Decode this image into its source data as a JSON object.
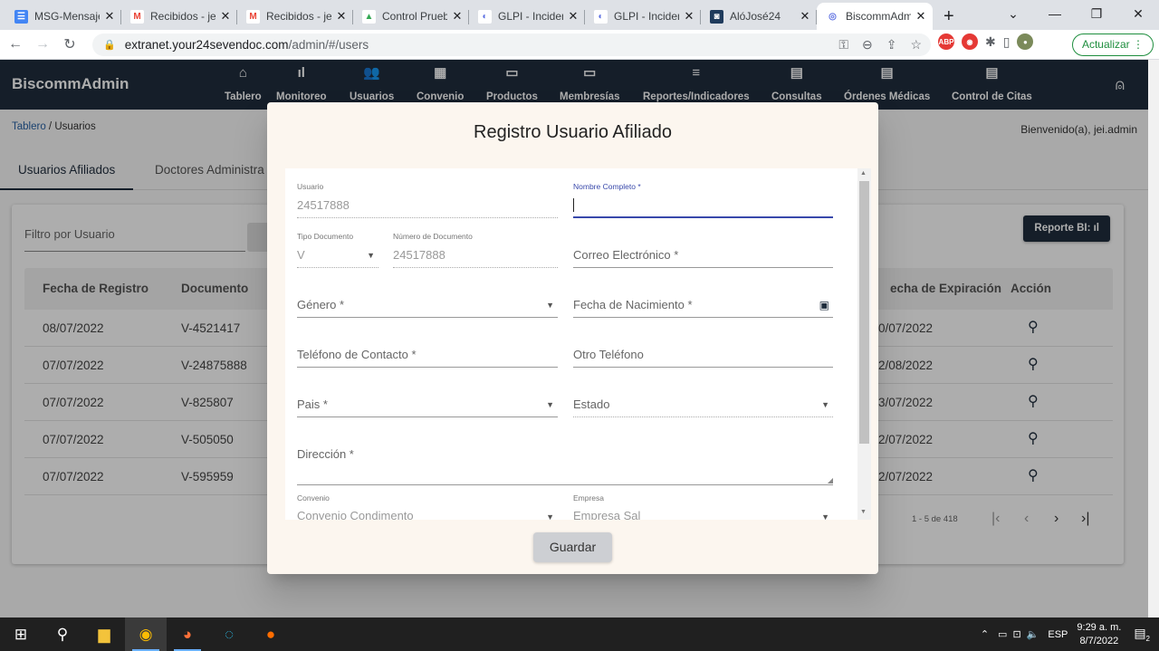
{
  "browser": {
    "tabs": [
      {
        "title": "MSG-Mensajes",
        "icon": "google-docs-icon",
        "color": "#4285f4",
        "glyph": "☰"
      },
      {
        "title": "Recibidos - jei",
        "icon": "gmail-icon",
        "color": "#ffffff",
        "glyph": "M"
      },
      {
        "title": "Recibidos - jei",
        "icon": "gmail-icon",
        "color": "#ffffff",
        "glyph": "M"
      },
      {
        "title": "Control Pruebas",
        "icon": "google-drive-icon",
        "color": "#ffffff",
        "glyph": "▲"
      },
      {
        "title": "GLPI - Incidencia",
        "icon": "glpi-icon",
        "color": "#ffffff",
        "glyph": "◐"
      },
      {
        "title": "GLPI - Incidencia",
        "icon": "glpi-icon",
        "color": "#ffffff",
        "glyph": "◐"
      },
      {
        "title": "AlóJosé24",
        "icon": "alojose-icon",
        "color": "#1f3b5c",
        "glyph": "◙"
      },
      {
        "title": "BiscommAdmin",
        "icon": "biscomm-icon",
        "color": "#ffffff",
        "glyph": "◎",
        "active": true
      }
    ],
    "url_host": "extranet.your24sevendoc.com",
    "url_path": "/admin/#/users",
    "update_label": "Actualizar"
  },
  "app": {
    "brand": "BiscommAdmin",
    "nav": [
      {
        "label": "Tablero",
        "icon": "home-icon",
        "glyph": "⌂"
      },
      {
        "label": "Monitoreo",
        "icon": "bar-chart-icon",
        "glyph": "ıl"
      },
      {
        "label": "Usuarios",
        "icon": "group-icon",
        "glyph": "👥"
      },
      {
        "label": "Convenio",
        "icon": "store-icon",
        "glyph": "▦"
      },
      {
        "label": "Productos",
        "icon": "card-icon",
        "glyph": "▭"
      },
      {
        "label": "Membresías",
        "icon": "card-icon",
        "glyph": "▭"
      },
      {
        "label": "Reportes/Indicadores",
        "icon": "list-icon",
        "glyph": "≡"
      },
      {
        "label": "Consultas",
        "icon": "calendar-icon",
        "glyph": "▤"
      },
      {
        "label": "Órdenes Médicas",
        "icon": "clipboard-icon",
        "glyph": "▤"
      },
      {
        "label": "Control de Citas",
        "icon": "calendar-icon",
        "glyph": "▤"
      }
    ],
    "breadcrumb_link": "Tablero",
    "breadcrumb_sep": " / ",
    "breadcrumb_current": "Usuarios",
    "welcome": "Bienvenido(a), jei.admin",
    "tabs": [
      "Usuarios Afiliados",
      "Doctores Administra"
    ],
    "filter_placeholder": "Filtro por Usuario",
    "report_btn": "Reporte BI:",
    "columns": [
      "Fecha de Registro",
      "Documento",
      "echa de Expiración",
      "Acción"
    ],
    "rows": [
      {
        "fecha": "08/07/2022",
        "doc": "V-4521417",
        "exp": "0/07/2022"
      },
      {
        "fecha": "07/07/2022",
        "doc": "V-24875888",
        "exp": "2/08/2022"
      },
      {
        "fecha": "07/07/2022",
        "doc": "V-825807",
        "exp": "3/07/2022"
      },
      {
        "fecha": "07/07/2022",
        "doc": "V-505050",
        "exp": "2/07/2022"
      },
      {
        "fecha": "07/07/2022",
        "doc": "V-595959",
        "exp": "2/07/2022"
      }
    ],
    "range": "1 - 5 de 418"
  },
  "dialog": {
    "title": "Registro Usuario Afiliado",
    "usuario_label": "Usuario",
    "usuario_value": "24517888",
    "nombre_label": "Nombre Completo *",
    "tipo_doc_label": "Tipo Documento",
    "tipo_doc_value": "V",
    "num_doc_label": "Número de Documento",
    "num_doc_value": "24517888",
    "correo_ph": "Correo Electrónico *",
    "genero_ph": "Género *",
    "fecha_nac_ph": "Fecha de Nacimiento *",
    "telefono_ph": "Teléfono de Contacto *",
    "otro_tel_ph": "Otro Teléfono",
    "pais_ph": "Pais *",
    "estado_ph": "Estado",
    "direccion_ph": "Dirección *",
    "convenio_label": "Convenio",
    "convenio_value": "Convenio Condimento",
    "empresa_label": "Empresa",
    "empresa_value": "Empresa Sal",
    "save_btn": "Guardar"
  },
  "taskbar": {
    "lang": "ESP",
    "time": "9:29 a. m.",
    "date": "8/7/2022",
    "notif_count": "2"
  }
}
